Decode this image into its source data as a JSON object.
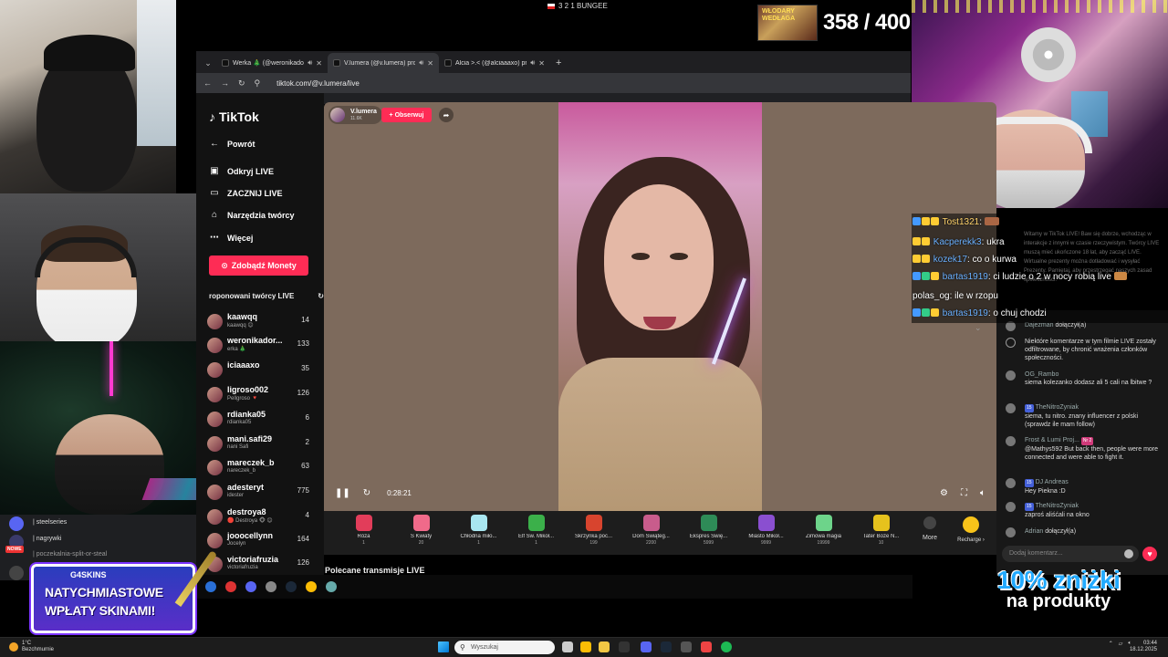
{
  "overlay": {
    "top_label": "3 2 1 BUNGEE",
    "counter": "358 / 400",
    "counter_thumb_label": "WŁODARY WEDŁAGA"
  },
  "browser": {
    "tabs": [
      {
        "label": "Werka 🎄 (@weronikadoro",
        "active": false
      },
      {
        "label": "V.lumera (@v.lumera) prow",
        "active": true
      },
      {
        "label": "Alcia >.< (@alciaaaxo) pro",
        "active": false
      }
    ],
    "url": "tiktok.com/@v.lumera/live"
  },
  "tiktok": {
    "logo": "TikTok",
    "nav": [
      {
        "label": "Powrót",
        "icon": "arrow-left-icon"
      },
      {
        "label": "Odkryj LIVE",
        "icon": "live-icon"
      },
      {
        "label": "ZACZNIJ LIVE",
        "icon": "camera-icon"
      },
      {
        "label": "Narzędzia twórcy",
        "icon": "home-icon"
      },
      {
        "label": "Więcej",
        "icon": "more-icon"
      }
    ],
    "coins_button": "Zdobądź Monety",
    "recommended_title": "roponowani twórcy LIVE",
    "creators": [
      {
        "name": "kaawqq",
        "sub": "kaawqq 😊",
        "count": "14"
      },
      {
        "name": "weronikador...",
        "sub": "erka 🎄",
        "count": "133"
      },
      {
        "name": "iciaaaxo",
        "sub": "",
        "count": "35"
      },
      {
        "name": "ligroso002",
        "sub": "Pellgroso 🔻",
        "count": "126"
      },
      {
        "name": "rdianka05",
        "sub": "rdianka05",
        "count": "6"
      },
      {
        "name": "mani.safi29",
        "sub": "nani Safi",
        "count": "2"
      },
      {
        "name": "mareczek_b",
        "sub": "nareczek_b",
        "count": "63"
      },
      {
        "name": "adesteryt",
        "sub": "idester",
        "count": "775"
      },
      {
        "name": "destroya8",
        "sub": "🔴 Destroya 🐵 😊",
        "count": "4"
      },
      {
        "name": "jooocellynn",
        "sub": "Jocelyn",
        "count": "164"
      },
      {
        "name": "victoriafruzia",
        "sub": "victoriafruzia",
        "count": "126"
      }
    ]
  },
  "player": {
    "host_name": "V.lumera",
    "host_viewers": "11.6K",
    "follow_label": "+ Obserwuj",
    "elapsed": "0:28:21"
  },
  "gifts": [
    {
      "name": "Róża",
      "price": "1",
      "color": "#e23d5a"
    },
    {
      "name": "S Kwiaty",
      "price": "20",
      "color": "#f06a8a"
    },
    {
      "name": "Chłodna miło...",
      "price": "1",
      "color": "#a8e6f0"
    },
    {
      "name": "Elf Św. Mikoł...",
      "price": "1",
      "color": "#3bb04a"
    },
    {
      "name": "Skrzynka poc...",
      "price": "199",
      "color": "#d8442e"
    },
    {
      "name": "Dom Świąteg...",
      "price": "2200",
      "color": "#c85c8c"
    },
    {
      "name": "Ekspres Świę...",
      "price": "5999",
      "color": "#2e8b57"
    },
    {
      "name": "Miasto Mikoł...",
      "price": "9999",
      "color": "#8a4fd0"
    },
    {
      "name": "Zimowa magia",
      "price": "19999",
      "color": "#6dd48a"
    },
    {
      "name": "Tater Boże N...",
      "price": "10",
      "color": "#e6c21d"
    }
  ],
  "gift_more": "More",
  "gift_recharge": "Recharge ›",
  "polecane": "Polecane transmisje LIVE",
  "stream_chat": {
    "welcome": "Witamy w TikTok LIVE! Baw się dobrze, wchodząc w interakcje z innymi w czasie rzeczywistym. Twórcy LIVE muszą mieć ukończone 18 lat, aby zacząć LIVE. Wirtualne prezenty można dotładować i wysyłać Prezenty. Pamiętaj, aby przestrzegać naszych zasad społeczności.",
    "lines": [
      {
        "user": "Tost1321",
        "text": "",
        "user_color": "gold"
      },
      {
        "user": "Kacperekk3",
        "text": "ukra",
        "user_color": "blue"
      },
      {
        "user": "kozek17",
        "text": "co o kurwa",
        "user_color": "blue"
      },
      {
        "user": "bartas1919",
        "text": "ci ludzie o 2 w nocy robią live",
        "user_color": "blue"
      },
      {
        "user": "polas_og",
        "text": "ile w rzopu",
        "user_color": "white"
      },
      {
        "user": "bartas1919",
        "text": "o chuj chodzi",
        "user_color": "blue"
      }
    ]
  },
  "tt_chat": {
    "messages": [
      {
        "name": "Dajezman",
        "text": "dołączył(a)"
      },
      {
        "name": "",
        "text": "Niektóre komentarze w tym filmie LIVE zostały odfiltrowane, by chronić wrażenia członków społeczności."
      },
      {
        "name": "OG_Rambo",
        "text": "siema kolezanko dodasz ali 5 cali na lbitwe ?"
      },
      {
        "name": "TheNitroZyniak",
        "badge": "15",
        "text": "siema, tu nitro. znany influencer z polski (sprawdz ile mam follow)"
      },
      {
        "name": "Frost & Lumi Proj...",
        "badge": "Nr 2",
        "text": "@Mathys592 But back then, people were more connected and were able to fight it."
      },
      {
        "name": "DJ Andreas",
        "badge": "15",
        "text": "Hey Piekna :D"
      },
      {
        "name": "TheNitroZyniak",
        "badge": "15",
        "text": "zaproś aliśćali na okno"
      },
      {
        "name": "Adrian",
        "text": "dołączył(a)"
      }
    ],
    "input_placeholder": "Dodaj komentarz..."
  },
  "channels": [
    {
      "label": "| steelseries"
    },
    {
      "label": "| nagrywki"
    },
    {
      "label": "| poczekalnia-split-or-steal"
    }
  ],
  "nowe_badge": "NOWE",
  "promo": {
    "brand": "G4SKINS",
    "line1": "NATYCHMIASTOWE",
    "line2": "WPŁATY SKINAMI!"
  },
  "discount": {
    "line1": "10% zniżki",
    "line2": "na produkty"
  },
  "taskbar": {
    "weather_temp": "1°C",
    "weather_desc": "Bezchmurnie",
    "search_placeholder": "Wyszukaj",
    "time": "03:44",
    "date": "18.12.2025"
  }
}
